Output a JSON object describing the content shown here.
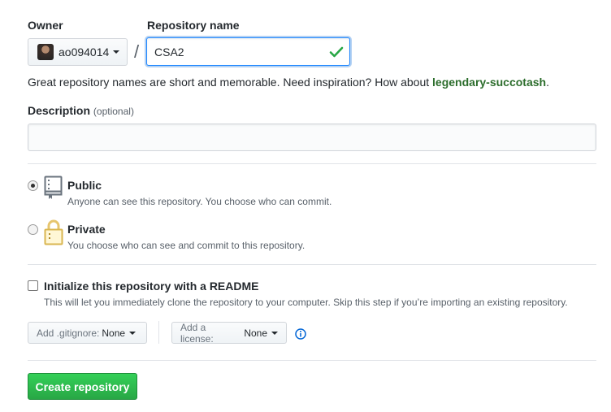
{
  "owner": {
    "label": "Owner",
    "username": "ao094014"
  },
  "repo": {
    "label": "Repository name",
    "separator": "/",
    "value": "CSA2"
  },
  "hint": {
    "text": "Great repository names are short and memorable. Need inspiration? How about ",
    "suggestion": "legendary-succotash",
    "end": "."
  },
  "description": {
    "label": "Description",
    "optional": "(optional)",
    "value": ""
  },
  "visibility": {
    "public": {
      "title": "Public",
      "note": "Anyone can see this repository. You choose who can commit.",
      "selected": true
    },
    "private": {
      "title": "Private",
      "note": "You choose who can see and commit to this repository.",
      "selected": false
    }
  },
  "readme": {
    "label": "Initialize this repository with a README",
    "note": "This will let you immediately clone the repository to your computer. Skip this step if you’re importing an existing repository.",
    "checked": false
  },
  "gitignore": {
    "prefix": "Add .gitignore:",
    "value": "None"
  },
  "license": {
    "prefix": "Add a license:",
    "value": "None"
  },
  "submit": {
    "label": "Create repository"
  },
  "colors": {
    "accent_green": "#28a745",
    "focus_blue": "#2188ff",
    "suggestion": "#2c6d2c"
  },
  "icons": {
    "valid": "check-icon",
    "public": "repo-book-icon",
    "private": "lock-icon",
    "info": "info-icon"
  }
}
